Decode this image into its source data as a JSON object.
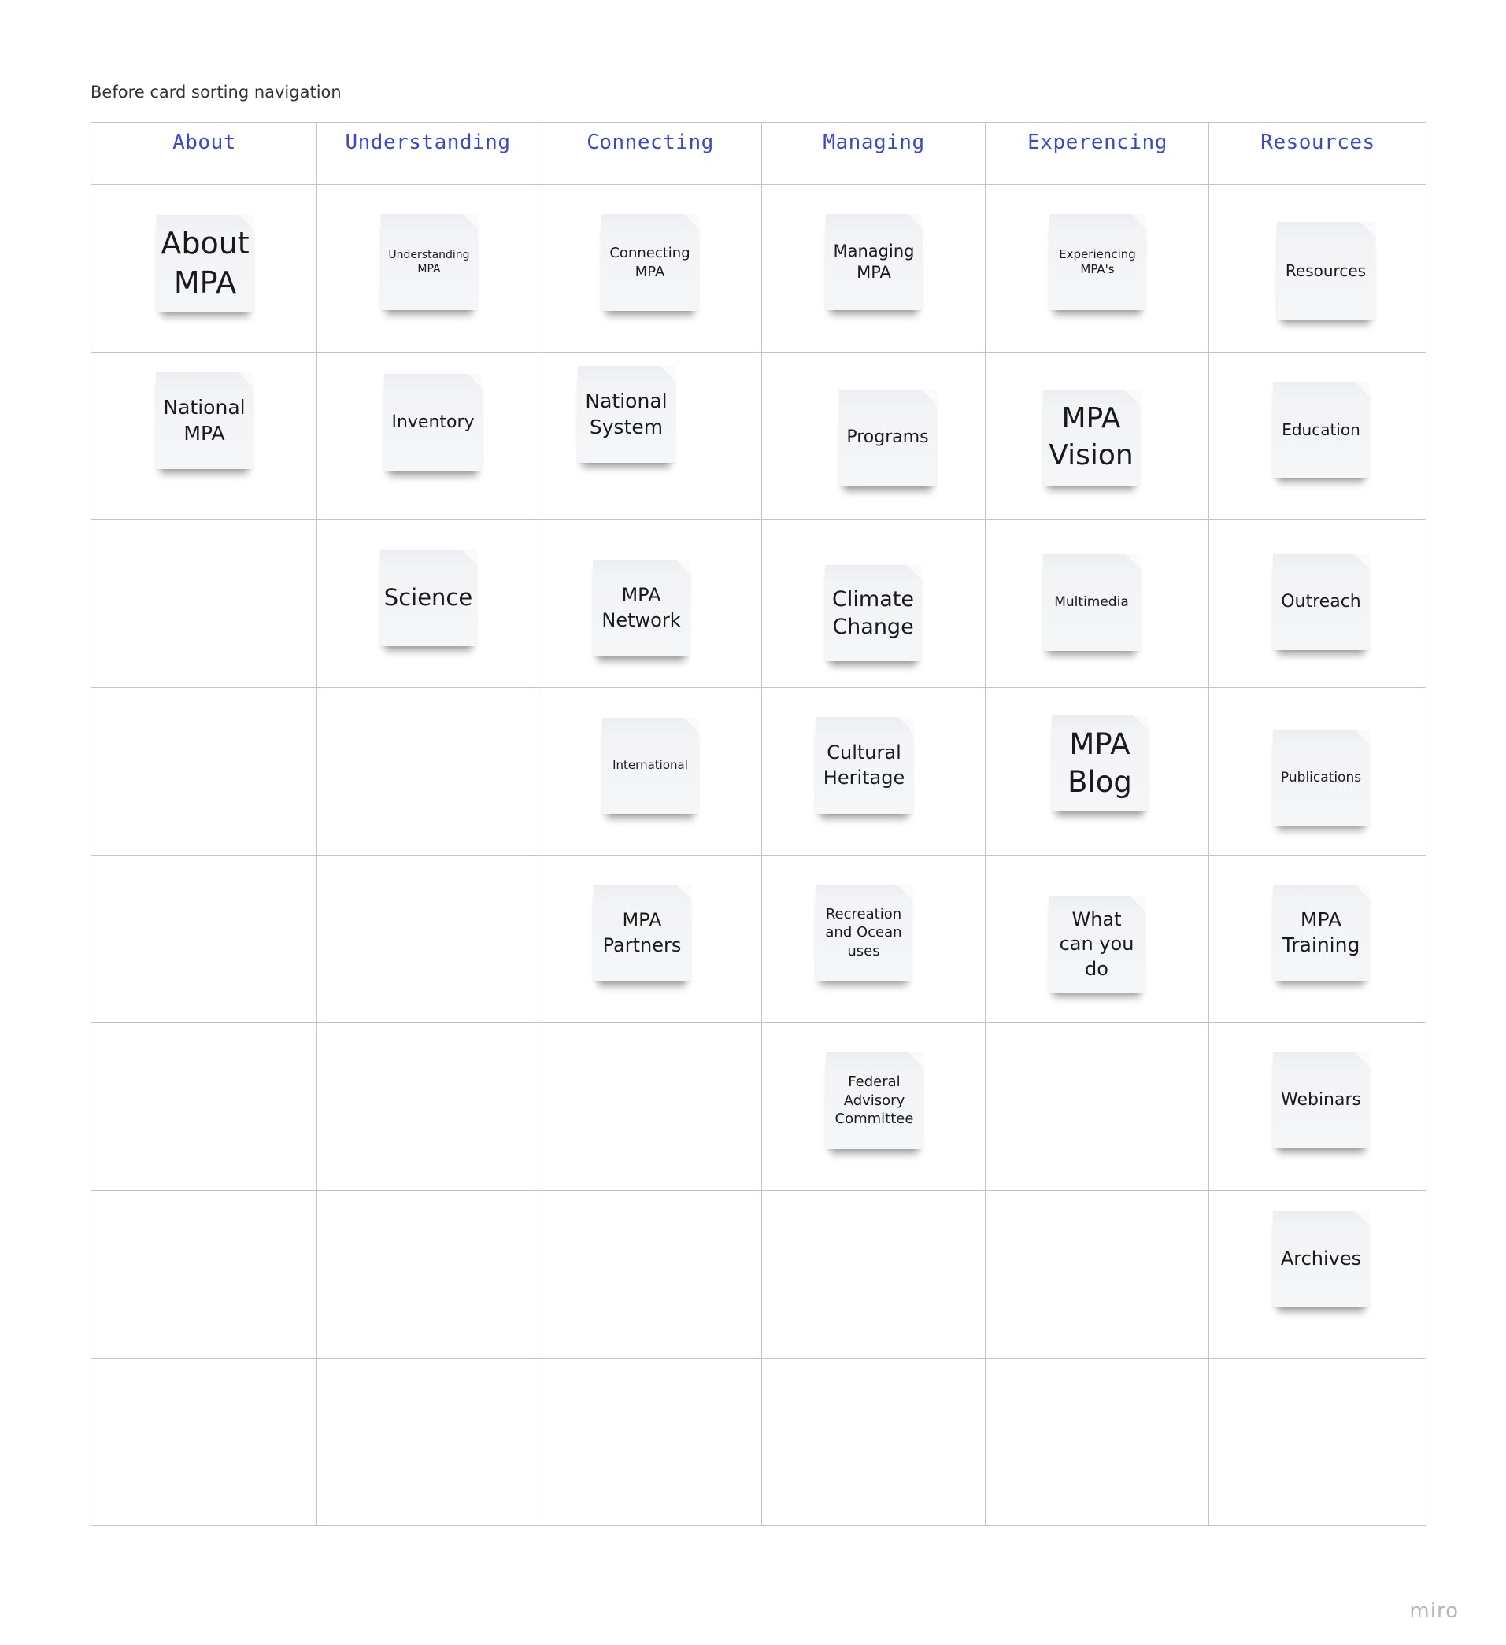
{
  "frame": {
    "title": "Before card sorting navigation"
  },
  "columns": [
    {
      "label": "About",
      "cards": [
        "About\nMPA",
        "National\nMPA"
      ]
    },
    {
      "label": "Understanding",
      "cards": [
        "Understanding\nMPA",
        "Inventory",
        "Science"
      ]
    },
    {
      "label": "Connecting",
      "cards": [
        "Connecting\nMPA",
        "National\nSystem",
        "MPA\nNetwork",
        "International",
        "MPA\nPartners"
      ]
    },
    {
      "label": "Managing",
      "cards": [
        "Managing\nMPA",
        "Programs",
        "Climate\nChange",
        "Cultural\nHeritage",
        "Recreation\nand Ocean\nuses",
        "Federal\nAdvisory\nCommittee"
      ]
    },
    {
      "label": "Experencing",
      "cards": [
        "Experiencing\nMPA's",
        "MPA\nVision",
        "Multimedia",
        "MPA\nBlog",
        "What\ncan you\ndo"
      ]
    },
    {
      "label": "Resources",
      "cards": [
        "Resources",
        "Education",
        "Outreach",
        "Publications",
        "MPA\nTraining",
        "Webinars",
        "Archives"
      ]
    }
  ],
  "colors": {
    "header_text": "#3c48c4",
    "grid_line": "#c4c4c4",
    "sticky_fill": "#f4f5f7"
  },
  "watermark": "miro"
}
